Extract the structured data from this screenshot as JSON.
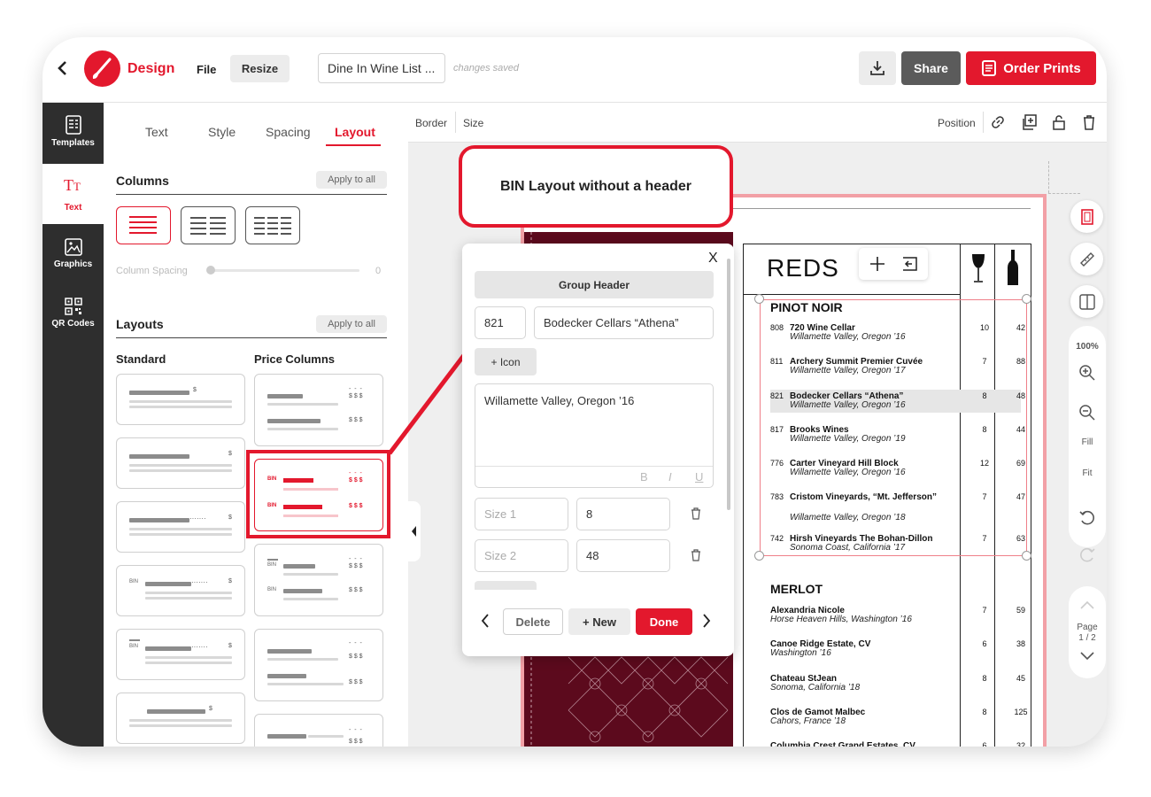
{
  "topbar": {
    "app_name": "Design",
    "menu_file": "File",
    "menu_resize": "Resize",
    "doc_title": "Dine In Wine List ...",
    "save_status": "changes saved",
    "share_label": "Share",
    "order_label": "Order Prints",
    "accent_color": "#e3182d"
  },
  "sidebar": {
    "items": [
      {
        "label": "Templates",
        "icon": "templates-icon"
      },
      {
        "label": "Text",
        "icon": "text-icon"
      },
      {
        "label": "Graphics",
        "icon": "image-icon"
      },
      {
        "label": "QR Codes",
        "icon": "qr-icon"
      }
    ],
    "active": "Text"
  },
  "panel": {
    "tabs": [
      "Text",
      "Style",
      "Spacing",
      "Layout"
    ],
    "active_tab": "Layout",
    "columns_title": "Columns",
    "apply_all": "Apply to all",
    "column_spacing_label": "Column Spacing",
    "column_spacing_value": "0",
    "layouts_title": "Layouts",
    "standard_title": "Standard",
    "price_columns_title": "Price Columns",
    "bin_label": "BIN",
    "dollar": "$",
    "dollars": "$ $ $"
  },
  "toolbar": {
    "border_label": "Border",
    "size_label": "Size",
    "position_label": "Position"
  },
  "callout": {
    "text": "BIN Layout without a header"
  },
  "editor": {
    "group_header_label": "Group Header",
    "bin_value": "821",
    "name_value": "Bodecker Cellars “Athena”",
    "icon_button": "+ Icon",
    "description_value": "Willamette Valley, Oregon ’16",
    "size1_placeholder": "Size 1",
    "size1_value": "8",
    "size2_placeholder": "Size 2",
    "size2_value": "48",
    "delete_label": "Delete",
    "new_label": "+ New",
    "done_label": "Done",
    "close_glyph": "X",
    "format_bold": "B",
    "format_italic": "I",
    "format_underline": "U"
  },
  "menu": {
    "section_title": "REDS",
    "pinot_title": "PINOT NOIR",
    "pinot": [
      {
        "bin": "808",
        "name": "720 Wine Cellar",
        "region": "Willamette Valley, Oregon ’16",
        "p1": "10",
        "p2": "42"
      },
      {
        "bin": "811",
        "name": "Archery Summit Premier Cuvée",
        "region": "Willamette Valley, Oregon ’17",
        "p1": "7",
        "p2": "88"
      },
      {
        "bin": "821",
        "name": "Bodecker Cellars “Athena”",
        "region": "Willamette Valley, Oregon ’16",
        "p1": "8",
        "p2": "48"
      },
      {
        "bin": "817",
        "name": "Brooks Wines",
        "region": "Willamette Valley, Oregon ’19",
        "p1": "8",
        "p2": "44"
      },
      {
        "bin": "776",
        "name": "Carter Vineyard Hill Block",
        "region": "Willamette Valley, Oregon ’16",
        "p1": "12",
        "p2": "69"
      },
      {
        "bin": "783",
        "name": "Cristom Vineyards, “Mt. Jefferson”",
        "region": "Willamette Valley, Oregon ’18",
        "p1": "7",
        "p2": "47"
      },
      {
        "bin": "742",
        "name": "Hirsh Vineyards The Bohan-Dillon",
        "region": "Sonoma Coast, California ’17",
        "p1": "7",
        "p2": "63"
      }
    ],
    "merlot_title": "MERLOT",
    "merlot": [
      {
        "bin": "",
        "name": "Alexandria Nicole",
        "region": "Horse Heaven Hills, Washington ’16",
        "p1": "7",
        "p2": "59"
      },
      {
        "bin": "",
        "name": "Canoe Ridge Estate, CV",
        "region": "Washington ’16",
        "p1": "6",
        "p2": "38"
      },
      {
        "bin": "",
        "name": "Chateau StJean",
        "region": "Sonoma, California ’18",
        "p1": "8",
        "p2": "45"
      },
      {
        "bin": "",
        "name": "Clos de Gamot Malbec",
        "region": "Cahors, France ’18",
        "p1": "8",
        "p2": "125"
      },
      {
        "bin": "",
        "name": "Columbia Crest Grand Estates, CV",
        "region": "",
        "p1": "6",
        "p2": "32"
      }
    ]
  },
  "right_rail": {
    "zoom": "100%",
    "fill_label": "Fill",
    "fit_label": "Fit",
    "page_label": "Page",
    "page_value": "1 / 2"
  }
}
